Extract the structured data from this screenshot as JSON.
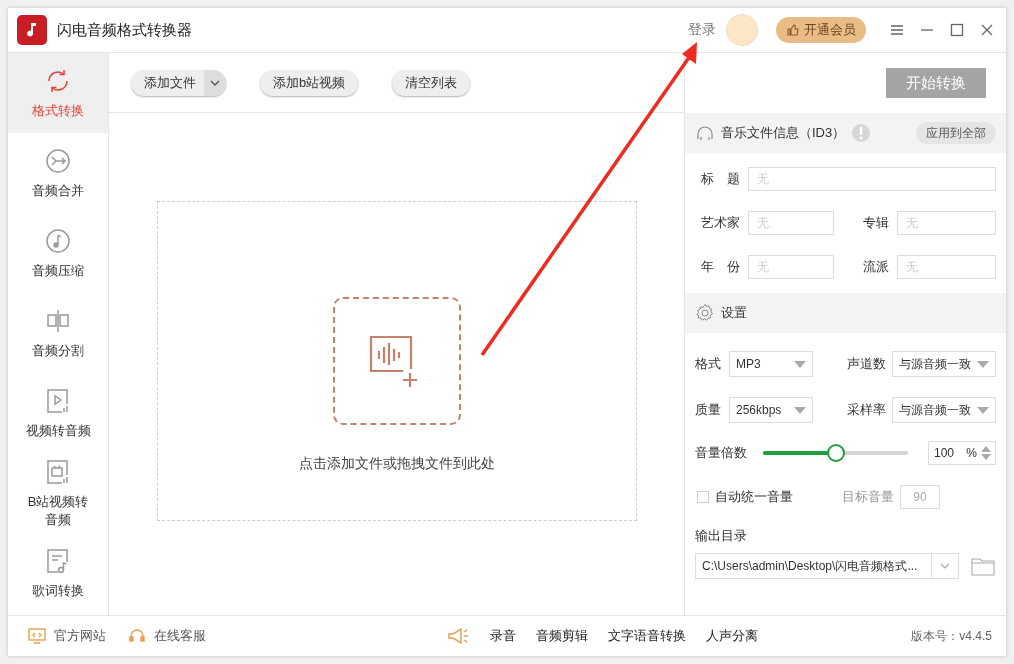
{
  "window": {
    "title": "闪电音频格式转换器",
    "login": "登录",
    "vip_button": "开通会员"
  },
  "sidebar": {
    "items": [
      {
        "label": "格式转换",
        "kind": "convert",
        "selected": true
      },
      {
        "label": "音频合并",
        "kind": "merge",
        "selected": false
      },
      {
        "label": "音频压缩",
        "kind": "compress",
        "selected": false
      },
      {
        "label": "音频分割",
        "kind": "split",
        "selected": false
      },
      {
        "label": "视频转音频",
        "kind": "video",
        "selected": false
      },
      {
        "label": "B站视频转音频",
        "kind": "tv",
        "selected": false
      },
      {
        "label": "歌词转换",
        "kind": "lyrics",
        "selected": false
      }
    ]
  },
  "toolbar": {
    "add_file": "添加文件",
    "add_bilibili": "添加b站视频",
    "clear": "清空列表",
    "start": "开始转换"
  },
  "dropzone": {
    "hint": "点击添加文件或拖拽文件到此处"
  },
  "id3": {
    "title": "音乐文件信息（ID3）",
    "apply_button": "应用到全部",
    "fields": [
      {
        "label": "标　题",
        "placeholder": "无",
        "kind": "wide"
      },
      {
        "label": "艺术家",
        "placeholder": "无",
        "kind": "half"
      },
      {
        "label": "专辑",
        "placeholder": "无",
        "kind": "half"
      },
      {
        "label": "年　份",
        "placeholder": "无",
        "kind": "half"
      },
      {
        "label": "流派",
        "placeholder": "无",
        "kind": "half"
      }
    ]
  },
  "settings": {
    "title": "设置",
    "selects": [
      {
        "label": "格式",
        "value": "MP3"
      },
      {
        "label": "声道数",
        "value": "与源音频一致"
      },
      {
        "label": "质量",
        "value": "256kbps"
      },
      {
        "label": "采样率",
        "value": "与源音频一致"
      }
    ],
    "volume": {
      "label": "音量倍数",
      "level": 0.5,
      "value": "100",
      "unit": "%"
    },
    "auto_volume": {
      "label": "自动统一音量",
      "checked": false
    },
    "target_volume": {
      "label": "目标音量",
      "placeholder": "90"
    },
    "output": {
      "label": "输出目录",
      "path": "C:\\Users\\admin\\Desktop\\闪电音频格式..."
    }
  },
  "footer": {
    "links": [
      {
        "label": "官方网站",
        "kind": "website"
      },
      {
        "label": "在线客服",
        "kind": "support"
      }
    ],
    "tools": [
      "录音",
      "音频剪辑",
      "文字语音转换",
      "人声分离"
    ],
    "version": "版本号：v4.4.5"
  }
}
